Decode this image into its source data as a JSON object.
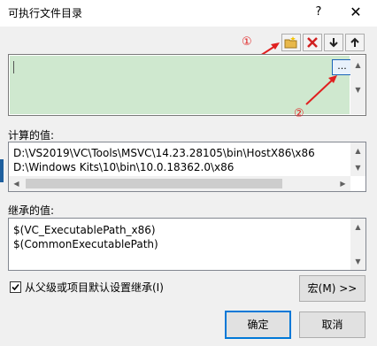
{
  "window": {
    "title": "可执行文件目录",
    "help_label": "?",
    "close_label": "✕"
  },
  "toolbar": {
    "buttons": [
      {
        "name": "new-line-button",
        "icon": "new-folder-icon"
      },
      {
        "name": "delete-button",
        "icon": "delete-x-icon"
      },
      {
        "name": "move-down-button",
        "icon": "arrow-down-icon"
      },
      {
        "name": "move-up-button",
        "icon": "arrow-up-icon"
      }
    ]
  },
  "editor": {
    "value": "",
    "browse_label": "..."
  },
  "annotations": {
    "marker1": "①",
    "marker2": "②",
    "color": "#e02020"
  },
  "evaluated": {
    "label": "计算的值:",
    "lines": [
      "D:\\VS2019\\VC\\Tools\\MSVC\\14.23.28105\\bin\\HostX86\\x86",
      "D:\\Windows Kits\\10\\bin\\10.0.18362.0\\x86"
    ]
  },
  "inherited": {
    "label": "继承的值:",
    "lines": [
      "$(VC_ExecutablePath_x86)",
      "$(CommonExecutablePath)"
    ]
  },
  "options": {
    "inherit_checkbox_label": "从父级或项目默认设置继承(I)",
    "inherit_checked": true
  },
  "buttons": {
    "macros_label": "宏(M) >>",
    "ok_label": "确定",
    "cancel_label": "取消"
  }
}
